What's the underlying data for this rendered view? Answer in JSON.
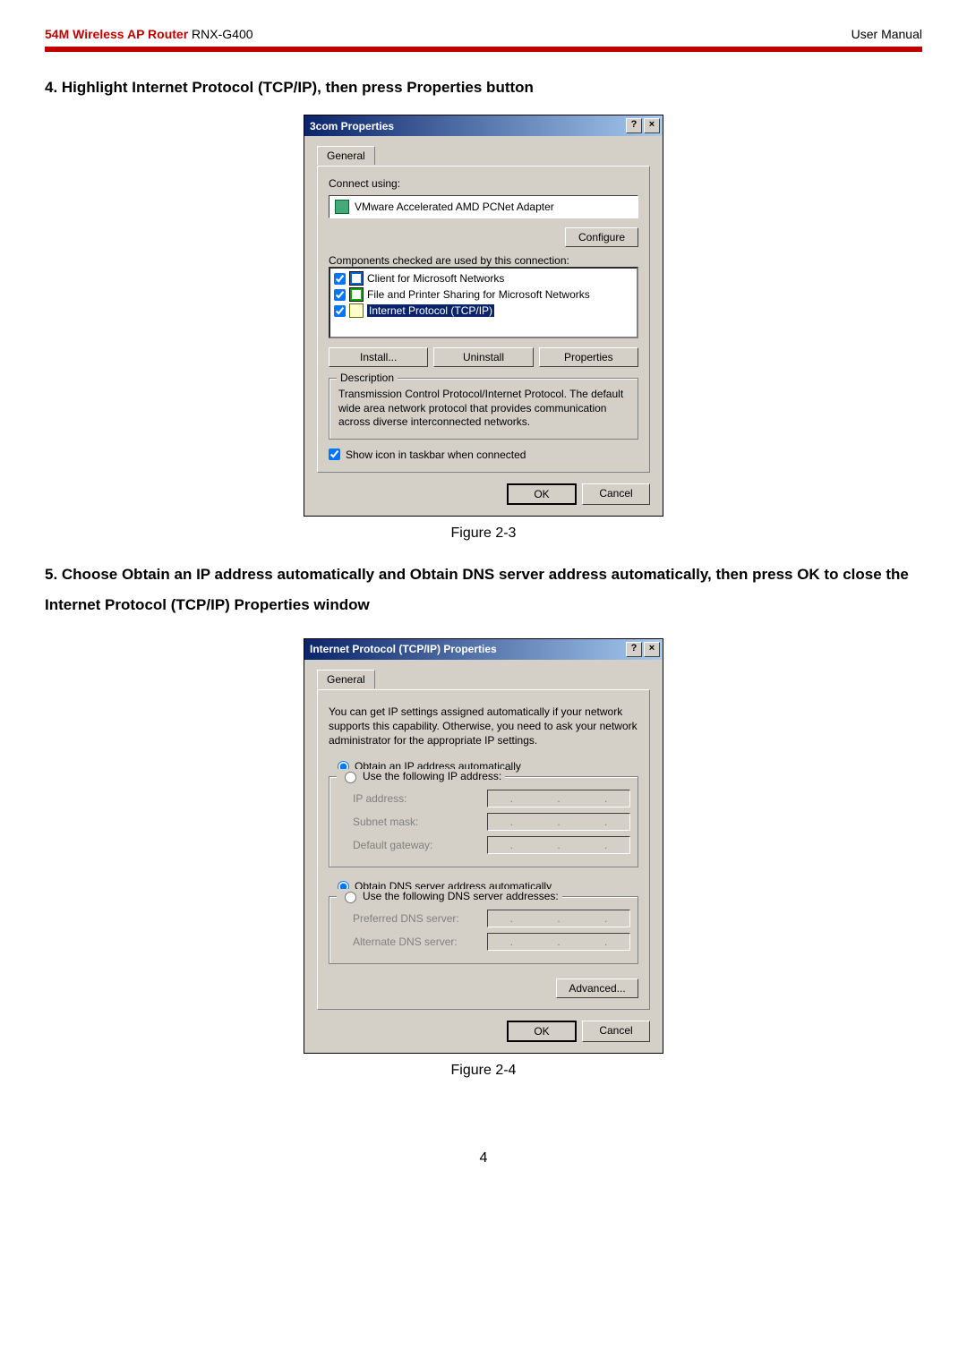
{
  "header": {
    "product_red": "54M Wireless AP Router",
    "model": "RNX-G400",
    "right": "User Manual"
  },
  "step4": "4. Highlight Internet Protocol (TCP/IP), then press Properties button",
  "dialog1": {
    "title": "3com Properties",
    "help_glyph": "?",
    "close_glyph": "×",
    "tab": "General",
    "connect_using_label": "Connect using:",
    "adapter": "VMware Accelerated AMD PCNet Adapter",
    "configure": "Configure",
    "components_label": "Components checked are used by this connection:",
    "items": [
      {
        "label": "Client for Microsoft Networks",
        "checked": true,
        "selected": false
      },
      {
        "label": "File and Printer Sharing for Microsoft Networks",
        "checked": true,
        "selected": false
      },
      {
        "label": "Internet Protocol (TCP/IP)",
        "checked": true,
        "selected": true
      }
    ],
    "install": "Install...",
    "uninstall": "Uninstall",
    "properties": "Properties",
    "description_legend": "Description",
    "description_text": "Transmission Control Protocol/Internet Protocol. The default wide area network protocol that provides communication across diverse interconnected networks.",
    "show_icon": "Show icon in taskbar when connected",
    "ok": "OK",
    "cancel": "Cancel"
  },
  "fig1": "Figure 2-3",
  "step5": "5. Choose Obtain an IP address automatically and Obtain DNS server address automatically, then press OK to close the Internet Protocol (TCP/IP) Properties window",
  "dialog2": {
    "title": "Internet Protocol (TCP/IP) Properties",
    "help_glyph": "?",
    "close_glyph": "×",
    "tab": "General",
    "intro": "You can get IP settings assigned automatically if your network supports this capability. Otherwise, you need to ask your network administrator for the appropriate IP settings.",
    "opt_auto_ip": "Obtain an IP address automatically",
    "opt_manual_ip": "Use the following IP address:",
    "ip_address": "IP address:",
    "subnet": "Subnet mask:",
    "gateway": "Default gateway:",
    "opt_auto_dns": "Obtain DNS server address automatically",
    "opt_manual_dns": "Use the following DNS server addresses:",
    "pref_dns": "Preferred DNS server:",
    "alt_dns": "Alternate DNS server:",
    "advanced": "Advanced...",
    "ok": "OK",
    "cancel": "Cancel"
  },
  "fig2": "Figure 2-4",
  "page_number": "4"
}
